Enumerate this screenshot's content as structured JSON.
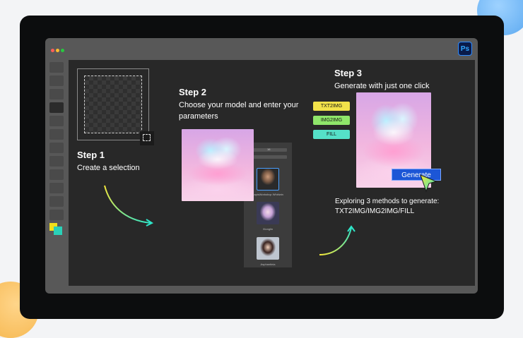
{
  "app": {
    "icon_label": "Ps"
  },
  "step1": {
    "title": "Step 1",
    "desc": "Create a selection"
  },
  "step2": {
    "title": "Step 2",
    "desc_line1": "Choose your model and enter your",
    "desc_line2": "parameters",
    "panel": {
      "field_value": "16",
      "models": [
        "LapisWorkshop Whirlwin",
        "Xionglin",
        "Asphantinia"
      ]
    }
  },
  "step3": {
    "title": "Step 3",
    "desc": "Generate with just one click",
    "methods": [
      "TXT2IMG",
      "IMG2IMG",
      "FILL"
    ],
    "generate_label": "Generate",
    "explore_line1": "Exploring 3 methods to generate:",
    "explore_line2": "TXT2IMG/IMG2IMG/FILL"
  },
  "colors": {
    "window_dots": [
      "#ff5f57",
      "#febc2e",
      "#28c840"
    ],
    "chip_colors": [
      "#f2e24a",
      "#8fe66a",
      "#55e0c8"
    ],
    "arrow_gradient": [
      "#f6e83a",
      "#2ee6c9"
    ],
    "generate_button": "#1c56d6",
    "foreground_swatch": "#f2e01a",
    "background_swatch": "#2ad1b8"
  }
}
